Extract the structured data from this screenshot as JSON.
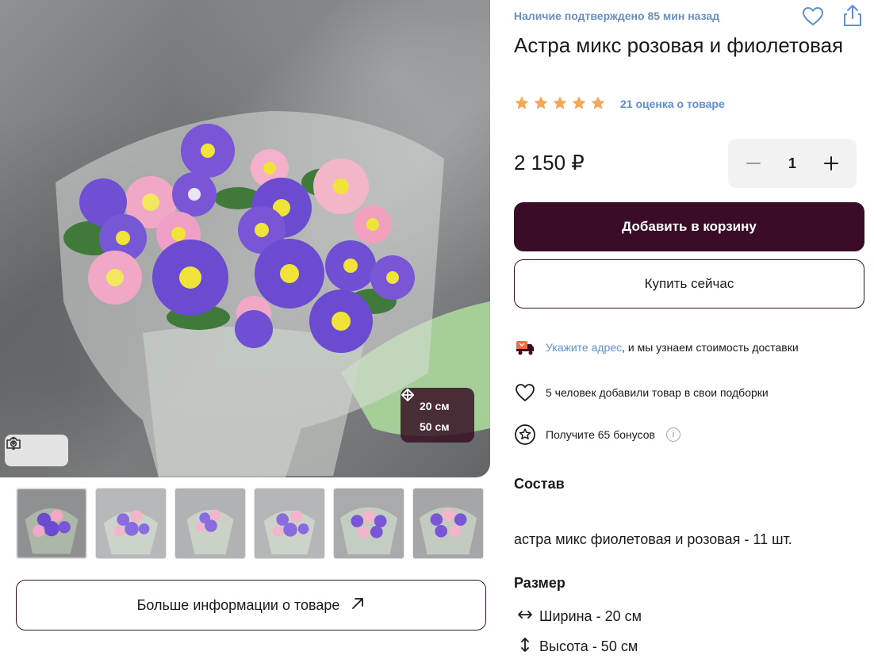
{
  "availability": "Наличие подтверждено 85 мин назад",
  "title": "Астра микс розовая и фиолетовая",
  "rating": {
    "stars": 5,
    "link_text": "21 оценка о товаре"
  },
  "price": "2 150 ₽",
  "quantity": "1",
  "buttons": {
    "add_to_cart": "Добавить в корзину",
    "buy_now": "Купить сейчас",
    "more_info": "Больше информации о товаре"
  },
  "delivery": {
    "link": "Укажите адрес",
    "text": ", и мы узнаем стоимость доставки"
  },
  "favorites_text": "5 человек добавили товар в свои подборки",
  "bonus_text": "Получите 65 бонусов",
  "photo_overlay": {
    "width": "20 см",
    "height": "50 см"
  },
  "composition": {
    "title": "Состав",
    "text": "астра микс фиолетовая и розовая - 11 шт."
  },
  "size": {
    "title": "Размер",
    "width": "Ширина - 20 см",
    "height": "Высота - 50 см"
  },
  "thumbnail_count": 6,
  "colors": {
    "brand": "#3a0c27",
    "link": "#5b8fd6",
    "availability": "#6b8fbf",
    "star": "#f5a75a"
  },
  "icons": [
    "heart-icon",
    "share-icon",
    "star-icon",
    "minus-icon",
    "plus-icon",
    "delivery-truck-icon",
    "heart-outline-icon",
    "bonus-star-icon",
    "info-icon",
    "camera-icon",
    "more-vertical-icon",
    "arrow-up-right-icon",
    "horizontal-arrows-icon",
    "vertical-arrows-icon"
  ]
}
